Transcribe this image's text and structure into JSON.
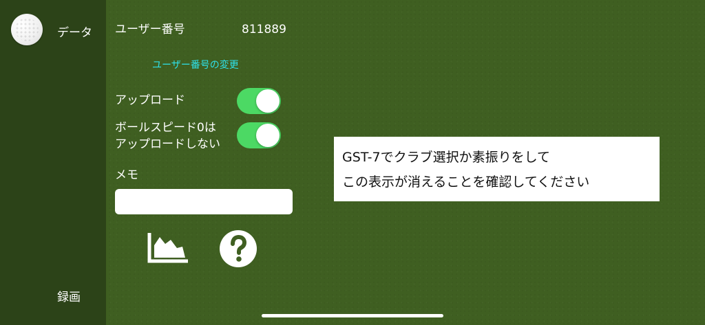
{
  "sidebar": {
    "data_label": "データ",
    "record_label": "録画",
    "ball_icon": "golf-ball-icon"
  },
  "settings": {
    "user_number_label": "ユーザー番号",
    "user_number_value": "811889",
    "change_user_number_link": "ユーザー番号の変更",
    "upload_label": "アップロード",
    "upload_enabled": true,
    "ball_speed_zero_label_line1": "ボールスピード0は",
    "ball_speed_zero_label_line2": "アップロードしない",
    "ball_speed_zero_enabled": true,
    "memo_label": "メモ",
    "memo_value": ""
  },
  "icons": {
    "chart": "area-chart-icon",
    "help": "question-icon"
  },
  "message": {
    "line1": "GST-7でクラブ選択か素振りをして",
    "line2": "この表示が消えることを確認してください"
  },
  "colors": {
    "background": "#3f5f21",
    "sidebar": "#2c4318",
    "toggle_on": "#4cd964",
    "link": "#2fe0e8"
  }
}
